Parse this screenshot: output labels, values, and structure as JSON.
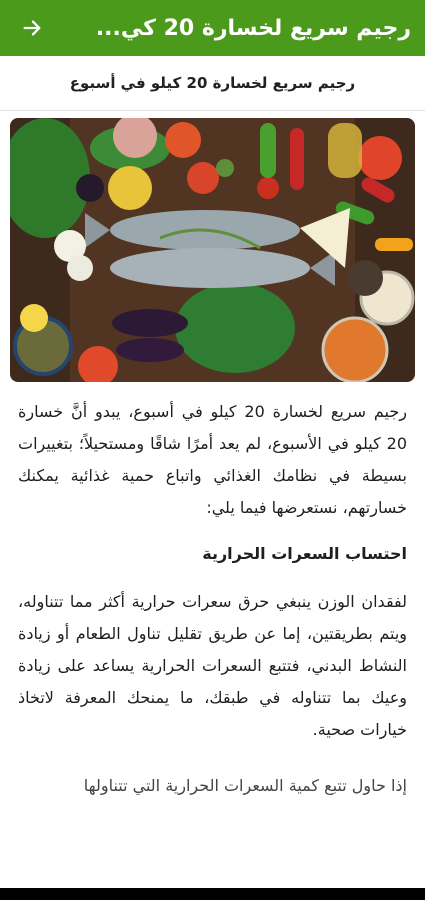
{
  "appbar": {
    "title": "رجيم سريع لخسارة 20 كي...",
    "color": "#4c9a1c"
  },
  "article": {
    "subtitle": "رجيم سريع لخسارة 20 كيلو  في أسبوع",
    "paragraph1": "رجيم سريع لخسارة 20 كيلو  في أسبوع، يبدو أنَّ خسارة 20 كيلو في الأسبوع، لم يعد أمرًا شاقًا ومستحيلاً؛ بتغييرات بسيطة في نظامك الغذائي واتباع حمية غذائية يمكنك خسارتهم، نستعرضها فيما يلي:",
    "heading1": "احتساب السعرات الحرارية",
    "paragraph2": "لفقدان الوزن ينبغي حرق سعرات حرارية أكثر مما تتناوله، ويتم بطريقتين، إما عن طريق تقليل تناول الطعام أو زيادة النشاط البدني، فتتبع السعرات الحرارية يساعد على زيادة وعيك بما تتناوله في طبقك، ما يمنحك المعرفة لاتخاذ خيارات صحية.",
    "paragraph3": "إذا حاول تتبع كمية السعرات الحرارية التي تتناولها"
  },
  "image": {
    "icon": "food-photo"
  }
}
